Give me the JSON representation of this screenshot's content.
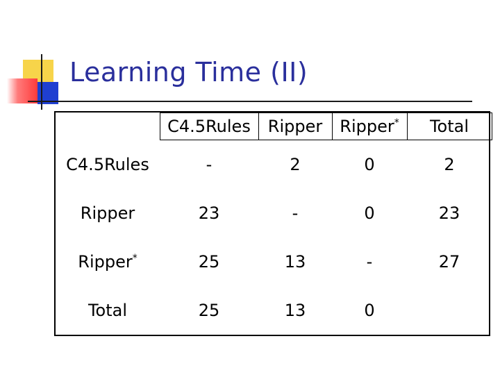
{
  "slide": {
    "title": "Learning Time (II)"
  },
  "table": {
    "columns": [
      "C4.5Rules",
      "Ripper",
      "Ripper",
      "Total"
    ],
    "column_superscripts": [
      "",
      "",
      "*",
      ""
    ],
    "rows": [
      {
        "label": "C4.5Rules",
        "sup": "",
        "cells": [
          "-",
          "2",
          "0",
          "2"
        ]
      },
      {
        "label": "Ripper",
        "sup": "",
        "cells": [
          "23",
          "-",
          "0",
          "23"
        ]
      },
      {
        "label": "Ripper",
        "sup": "*",
        "cells": [
          "25",
          "13",
          "-",
          "27"
        ]
      },
      {
        "label": "Total",
        "sup": "",
        "cells": [
          "25",
          "13",
          "0",
          ""
        ]
      }
    ]
  },
  "colors": {
    "title": "#2a2f9c",
    "logo_yellow": "#f7d44a",
    "logo_red": "#ff3b3b",
    "logo_blue": "#1f3fd1"
  }
}
